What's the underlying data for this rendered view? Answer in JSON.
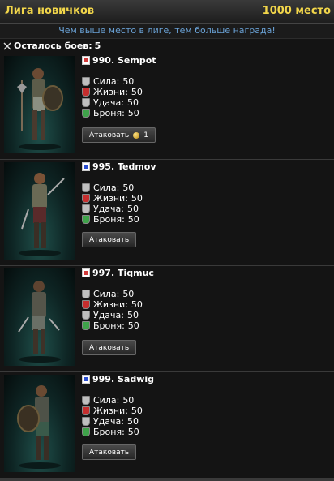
{
  "header": {
    "league_title": "Лига новичков",
    "place": "1000 место"
  },
  "subtitle": "Чем выше место в лиге, тем больше награда!",
  "battles": {
    "label": "Осталось боев:",
    "count": "5"
  },
  "colors": {
    "gold": "#f2d64a",
    "link_blue": "#6aa2d6",
    "flag_red": "#d23b3b",
    "flag_blue": "#2b4fd1",
    "strength_gray": "#bfbfbf",
    "life_red": "#c62e2e",
    "luck_gray": "#bfbfbf",
    "armor_green": "#3fa34a"
  },
  "opponents": [
    {
      "name": "990. Sempot",
      "flag": "red",
      "stats": [
        {
          "label": "Сила:",
          "value": "50",
          "icon": "strength-shield-icon"
        },
        {
          "label": "Жизни:",
          "value": "50",
          "icon": "life-shield-icon"
        },
        {
          "label": "Удача:",
          "value": "50",
          "icon": "luck-shield-icon"
        },
        {
          "label": "Броня:",
          "value": "50",
          "icon": "armor-shield-icon"
        }
      ],
      "attack_label": "Атаковать",
      "attack_cost": "1"
    },
    {
      "name": "995. Tedmov",
      "flag": "blue",
      "stats": [
        {
          "label": "Сила:",
          "value": "50",
          "icon": "strength-shield-icon"
        },
        {
          "label": "Жизни:",
          "value": "50",
          "icon": "life-shield-icon"
        },
        {
          "label": "Удача:",
          "value": "50",
          "icon": "luck-shield-icon"
        },
        {
          "label": "Броня:",
          "value": "50",
          "icon": "armor-shield-icon"
        }
      ],
      "attack_label": "Атаковать"
    },
    {
      "name": "997. Tiqmuc",
      "flag": "red",
      "stats": [
        {
          "label": "Сила:",
          "value": "50",
          "icon": "strength-shield-icon"
        },
        {
          "label": "Жизни:",
          "value": "50",
          "icon": "life-shield-icon"
        },
        {
          "label": "Удача:",
          "value": "50",
          "icon": "luck-shield-icon"
        },
        {
          "label": "Броня:",
          "value": "50",
          "icon": "armor-shield-icon"
        }
      ],
      "attack_label": "Атаковать"
    },
    {
      "name": "999. Sadwig",
      "flag": "blue",
      "stats": [
        {
          "label": "Сила:",
          "value": "50",
          "icon": "strength-shield-icon"
        },
        {
          "label": "Жизни:",
          "value": "50",
          "icon": "life-shield-icon"
        },
        {
          "label": "Удача:",
          "value": "50",
          "icon": "luck-shield-icon"
        },
        {
          "label": "Броня:",
          "value": "50",
          "icon": "armor-shield-icon"
        }
      ],
      "attack_label": "Атаковать"
    }
  ]
}
